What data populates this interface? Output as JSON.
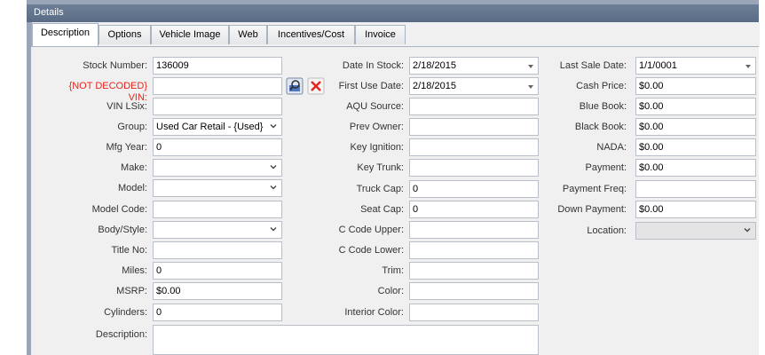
{
  "window": {
    "title": "Details"
  },
  "tabs": [
    "Description",
    "Options",
    "Vehicle Image",
    "Web",
    "Incentives/Cost",
    "Invoice"
  ],
  "fields": {
    "stock_number": {
      "label": "Stock Number:",
      "value": "136009"
    },
    "vin": {
      "label": "{NOT DECODED} VIN:",
      "value": ""
    },
    "vin_lsix": {
      "label": "VIN LSix:",
      "value": ""
    },
    "group": {
      "label": "Group:",
      "value": "Used Car Retail - {Used}"
    },
    "mfg_year": {
      "label": "Mfg Year:",
      "value": "0"
    },
    "make": {
      "label": "Make:",
      "value": ""
    },
    "model": {
      "label": "Model:",
      "value": ""
    },
    "model_code": {
      "label": "Model Code:",
      "value": ""
    },
    "body_style": {
      "label": "Body/Style:",
      "value": ""
    },
    "title_no": {
      "label": "Title No:",
      "value": ""
    },
    "miles": {
      "label": "Miles:",
      "value": "0"
    },
    "msrp": {
      "label": "MSRP:",
      "value": "$0.00"
    },
    "cylinders": {
      "label": "Cylinders:",
      "value": "0"
    },
    "description": {
      "label": "Description:",
      "value": ""
    },
    "date_in_stock": {
      "label": "Date In Stock:",
      "value": "2/18/2015"
    },
    "first_use_date": {
      "label": "First Use Date:",
      "value": "2/18/2015"
    },
    "aqu_source": {
      "label": "AQU Source:",
      "value": ""
    },
    "prev_owner": {
      "label": "Prev Owner:",
      "value": ""
    },
    "key_ignition": {
      "label": "Key Ignition:",
      "value": ""
    },
    "key_trunk": {
      "label": "Key Trunk:",
      "value": ""
    },
    "truck_cap": {
      "label": "Truck Cap:",
      "value": "0"
    },
    "seat_cap": {
      "label": "Seat Cap:",
      "value": "0"
    },
    "c_code_upper": {
      "label": "C Code Upper:",
      "value": ""
    },
    "c_code_lower": {
      "label": "C Code Lower:",
      "value": ""
    },
    "trim": {
      "label": "Trim:",
      "value": ""
    },
    "color": {
      "label": "Color:",
      "value": ""
    },
    "interior_color": {
      "label": "Interior Color:",
      "value": ""
    },
    "last_sale_date": {
      "label": "Last Sale Date:",
      "value": "1/1/0001"
    },
    "cash_price": {
      "label": "Cash Price:",
      "value": "$0.00"
    },
    "blue_book": {
      "label": "Blue Book:",
      "value": "$0.00"
    },
    "black_book": {
      "label": "Black Book:",
      "value": "$0.00"
    },
    "nada": {
      "label": "NADA:",
      "value": "$0.00"
    },
    "payment": {
      "label": "Payment:",
      "value": "$0.00"
    },
    "payment_freq": {
      "label": "Payment Freq:",
      "value": ""
    },
    "down_payment": {
      "label": "Down Payment:",
      "value": "$0.00"
    },
    "location": {
      "label": "Location:",
      "value": ""
    }
  },
  "icons": {
    "decode": "decode-vin-icon",
    "clear": "clear-vin-icon"
  },
  "colors": {
    "title_bar": "#5f718a",
    "label_error": "#e8231a",
    "panel": "#f0f0f0"
  }
}
